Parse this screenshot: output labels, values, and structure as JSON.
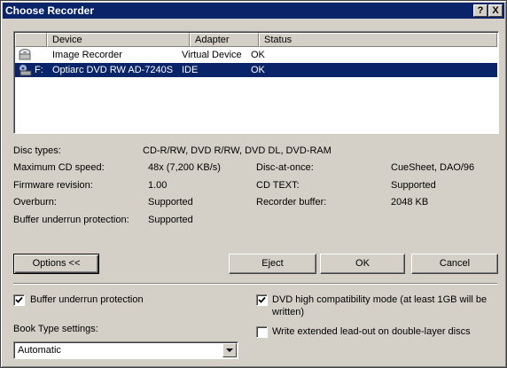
{
  "window": {
    "title": "Choose Recorder",
    "help_glyph": "?",
    "close_glyph": "X"
  },
  "list": {
    "columns": [
      "Device",
      "Adapter",
      "Status"
    ],
    "rows": [
      {
        "device": "Image Recorder",
        "adapter": "Virtual Device",
        "status": "OK",
        "icon": "image-recorder-icon",
        "selected": false,
        "prefix": ""
      },
      {
        "device": "Optiarc DVD RW AD-7240S",
        "adapter": "IDE",
        "status": "OK",
        "icon": "optical-drive-icon",
        "selected": true,
        "prefix": "F:"
      }
    ]
  },
  "info": {
    "disc_types_label": "Disc types:",
    "disc_types_value": "CD-R/RW, DVD R/RW, DVD DL, DVD-RAM",
    "max_speed_label": "Maximum CD speed:",
    "max_speed_value": "48x (7,200 KB/s)",
    "firmware_label": "Firmware revision:",
    "firmware_value": "1.00",
    "overburn_label": "Overburn:",
    "overburn_value": "Supported",
    "buffer_prot_label": "Buffer underrun protection:",
    "buffer_prot_value": "Supported",
    "dao_label": "Disc-at-once:",
    "dao_value": "CueSheet, DAO/96",
    "cdtext_label": "CD TEXT:",
    "cdtext_value": "Supported",
    "recbuf_label": "Recorder buffer:",
    "recbuf_value": "2048 KB"
  },
  "buttons": {
    "options": "Options <<",
    "eject": "Eject",
    "ok": "OK",
    "cancel": "Cancel"
  },
  "options": {
    "buffer_underrun": {
      "label": "Buffer underrun protection",
      "checked": true
    },
    "dvd_compat": {
      "label_line1": "DVD high compatibility mode (at least 1GB will be",
      "label_line2": "written)",
      "checked": true
    },
    "extended_leadout": {
      "label": "Write extended lead-out on double-layer discs",
      "checked": false
    },
    "book_type_label": "Book Type settings:",
    "book_type_value": "Automatic"
  },
  "colors": {
    "selection": "#0a246a",
    "face": "#d4d0c8",
    "titlebar": "#0a246a"
  }
}
